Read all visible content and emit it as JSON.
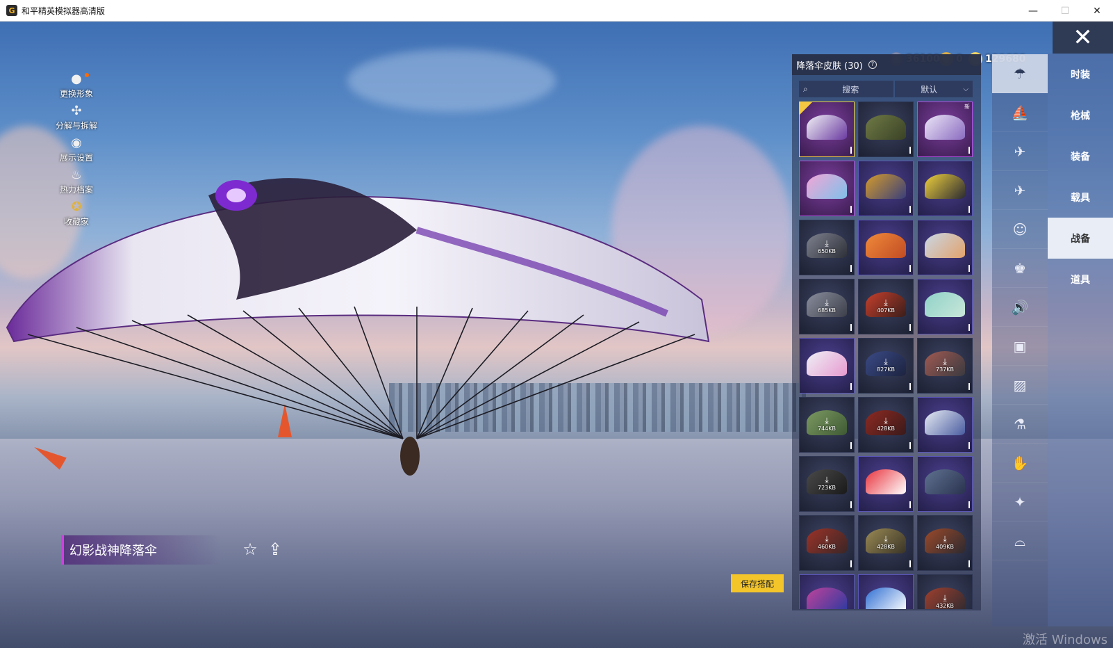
{
  "window": {
    "title": "和平精英模拟器高清版",
    "app_icon_letter": "G",
    "minimize": "—",
    "maximize": "☐",
    "close": "✕"
  },
  "left_menu": [
    {
      "label": "更换形象",
      "icon": "avatar-icon"
    },
    {
      "label": "分解与拆解",
      "icon": "puzzle-icon"
    },
    {
      "label": "展示设置",
      "icon": "eye-icon"
    },
    {
      "label": "热力档案",
      "icon": "flame-icon"
    },
    {
      "label": "收藏家",
      "icon": "collector-badge-icon"
    }
  ],
  "currency": [
    {
      "value": "36100",
      "icon": "silver-coin-icon",
      "color": "#4b5a8a"
    },
    {
      "value": "0",
      "icon": "gold-coin-icon",
      "color": "#c8962a"
    },
    {
      "value": "129680",
      "icon": "bp-coin-icon",
      "color": "#e8c43a"
    }
  ],
  "close_glyph": "✕",
  "panel": {
    "title": "降落伞皮肤 (30)",
    "help": "?",
    "search_icon": "⌕",
    "search_label": "搜索",
    "sort_label": "默认",
    "sort_chevron": "⌵"
  },
  "skins": [
    {
      "style": "purple",
      "selected": true,
      "colors": [
        "#f2f2f6",
        "#6a3aa0"
      ],
      "size": ""
    },
    {
      "style": "plain",
      "colors": [
        "#6f7a45",
        "#3a4226"
      ],
      "size": ""
    },
    {
      "style": "purple",
      "new": "新",
      "colors": [
        "#ece6f7",
        "#8a6bc0"
      ],
      "size": ""
    },
    {
      "style": "purple",
      "colors": [
        "#f2a6d6",
        "#7fc0ea"
      ],
      "size": ""
    },
    {
      "style": "violet",
      "colors": [
        "#d59c2c",
        "#3a3f7a"
      ],
      "size": ""
    },
    {
      "style": "violet",
      "colors": [
        "#f1d23c",
        "#2b2b33"
      ],
      "size": ""
    },
    {
      "style": "plain",
      "download": true,
      "size": "650KB",
      "colors": [
        "#7f8390",
        "#2e3038"
      ]
    },
    {
      "style": "violet",
      "colors": [
        "#f08a3a",
        "#c14c24"
      ],
      "size": ""
    },
    {
      "style": "violet",
      "colors": [
        "#c9d7e6",
        "#e2a26b"
      ],
      "size": ""
    },
    {
      "style": "plain",
      "download": true,
      "size": "685KB",
      "colors": [
        "#8b8f9e",
        "#3c3f4a"
      ]
    },
    {
      "style": "plain",
      "download": true,
      "size": "407KB",
      "colors": [
        "#c7402d",
        "#3a1e1a"
      ]
    },
    {
      "style": "violet",
      "colors": [
        "#8fd2c8",
        "#c9e6d9"
      ],
      "size": ""
    },
    {
      "style": "violet",
      "colors": [
        "#eef0f6",
        "#e79ad0"
      ],
      "size": ""
    },
    {
      "style": "plain",
      "download": true,
      "size": "827KB",
      "colors": [
        "#3a4a86",
        "#1d2440"
      ]
    },
    {
      "style": "plain",
      "download": true,
      "size": "737KB",
      "colors": [
        "#a15a52",
        "#3a3a40"
      ]
    },
    {
      "style": "plain",
      "download": true,
      "size": "744KB",
      "colors": [
        "#7c9a62",
        "#3f5a34"
      ]
    },
    {
      "style": "plain",
      "download": true,
      "size": "428KB",
      "colors": [
        "#8e2a22",
        "#3a1a1a"
      ]
    },
    {
      "style": "violet",
      "colors": [
        "#e7ecf3",
        "#4a5ca0"
      ],
      "size": ""
    },
    {
      "style": "plain",
      "download": true,
      "size": "723KB",
      "colors": [
        "#4a4a4a",
        "#1a1a1a"
      ]
    },
    {
      "style": "violet",
      "colors": [
        "#e8323c",
        "#ffffff"
      ],
      "size": ""
    },
    {
      "style": "violet",
      "colors": [
        "#5f7290",
        "#2a3350"
      ],
      "size": ""
    },
    {
      "style": "plain",
      "download": true,
      "size": "460KB",
      "colors": [
        "#9b3328",
        "#3b2626"
      ]
    },
    {
      "style": "plain",
      "download": true,
      "size": "428KB",
      "colors": [
        "#9a8a55",
        "#3a3426"
      ]
    },
    {
      "style": "plain",
      "download": true,
      "size": "409KB",
      "colors": [
        "#9b4a2a",
        "#2e2a30"
      ]
    },
    {
      "style": "violet",
      "colors": [
        "#c0439a",
        "#2b3aa0"
      ],
      "size": ""
    },
    {
      "style": "violet",
      "colors": [
        "#2f6fd2",
        "#ffffff"
      ],
      "size": ""
    },
    {
      "style": "plain",
      "download": true,
      "size": "432KB",
      "colors": [
        "#a0402e",
        "#2e2a30"
      ]
    }
  ],
  "categories": [
    {
      "icon": "parachute-icon",
      "glyph": "☂",
      "active": true
    },
    {
      "icon": "boat-icon",
      "glyph": "⛵"
    },
    {
      "icon": "drone-icon",
      "glyph": "✈"
    },
    {
      "icon": "airplane-icon",
      "glyph": "✈"
    },
    {
      "icon": "emote-icon",
      "glyph": "☺"
    },
    {
      "icon": "companion-icon",
      "glyph": "♚"
    },
    {
      "icon": "voice-icon",
      "glyph": "🔊"
    },
    {
      "icon": "gamepad-icon",
      "glyph": "▣"
    },
    {
      "icon": "picture-icon",
      "glyph": "▨"
    },
    {
      "icon": "spray-icon",
      "glyph": "⚗"
    },
    {
      "icon": "hand-gesture-icon",
      "glyph": "✋"
    },
    {
      "icon": "magic-wand-icon",
      "glyph": "✦"
    },
    {
      "icon": "hat-icon",
      "glyph": "⌓"
    }
  ],
  "tabs": [
    {
      "label": "时装"
    },
    {
      "label": "枪械"
    },
    {
      "label": "装备"
    },
    {
      "label": "载具"
    },
    {
      "label": "战备",
      "active": true
    },
    {
      "label": "道具"
    }
  ],
  "selected_item": {
    "name": "幻影战神降落伞",
    "favorite_glyph": "☆",
    "share_glyph": "⇪"
  },
  "save_button": "保存搭配",
  "watermark": "激活 Windows"
}
